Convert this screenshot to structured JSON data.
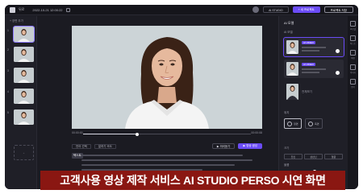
{
  "topbar": {
    "back_label": "뒤로",
    "project_title": "2022-10-21 12:00:22",
    "ghost_button": "AI STUDIO",
    "primary_button": "+ 새 프로젝트",
    "outline_button": "프로젝트 저장"
  },
  "scenes": {
    "add_label": "+ 장면 추가",
    "numbers": [
      "1",
      "2",
      "3",
      "4",
      "5"
    ],
    "empty_label": "+"
  },
  "timeline": {
    "start": "00:00:00",
    "end": "00:00:08",
    "progress": 0.32
  },
  "script": {
    "language_label": "언어 선택",
    "speed_label": "말하기 속도",
    "play_label": "▶ 미리듣기",
    "generate_label": "▶ 영상 생성",
    "tag_label": "텍스트"
  },
  "right_panel": {
    "tab_label": "AI 모델",
    "section_model": "AI 모델",
    "model_badges": [
      "AI VIDEO",
      "AI VIDEO"
    ],
    "other_label": "전체보기",
    "section_position": "위치",
    "position_labels": [
      "정면",
      "측면"
    ],
    "section_size": "크기",
    "size_options": [
      "전신",
      "상반신",
      "얼굴"
    ],
    "section_volume": "볼륨",
    "section_speed": "속도"
  },
  "rail": {
    "labels": [
      "AI모델",
      "텍스트",
      "배경",
      "이미지",
      "음악"
    ]
  },
  "caption": {
    "text": "고객사용 영상 제작 서비스 AI STUDIO PERSO 시연 화면"
  },
  "colors": {
    "accent": "#6b4cf6",
    "caption_bg": "#8a1712",
    "app_bg": "#1b1b22",
    "canvas_bg": "#ccd4d7"
  }
}
